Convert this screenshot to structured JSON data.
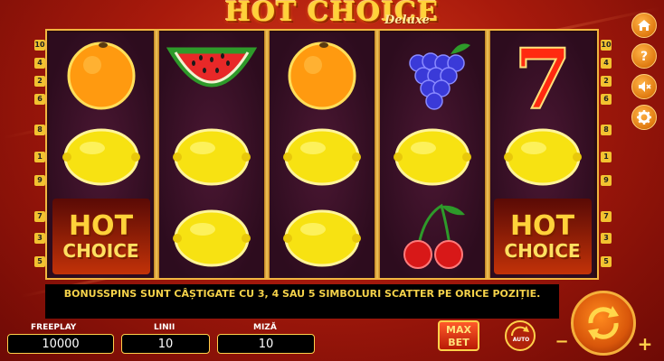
{
  "title": {
    "main": "HOT CHOICE",
    "sub": "Deluxe"
  },
  "reels": [
    [
      "orange",
      "lemon",
      "hot-choice"
    ],
    [
      "watermelon",
      "lemon",
      "lemon"
    ],
    [
      "orange",
      "lemon",
      "lemon"
    ],
    [
      "grapes",
      "lemon",
      "cherries"
    ],
    [
      "seven",
      "lemon",
      "hot-choice"
    ]
  ],
  "hot_choice_logo": {
    "line1": "HOT",
    "line2": "CHOICE"
  },
  "line_numbers_left": [
    "10",
    "4",
    "2",
    "6",
    "8",
    "1",
    "9",
    "7",
    "3",
    "5"
  ],
  "line_numbers_right": [
    "10",
    "4",
    "2",
    "6",
    "8",
    "1",
    "9",
    "7",
    "3",
    "5"
  ],
  "side_buttons": [
    "home-icon",
    "help-icon",
    "sound-off-icon",
    "settings-icon"
  ],
  "message": "BONUSSPINS SUNT CÂȘTIGATE CU 3, 4 SAU 5 SIMBOLURI SCATTER PE ORICE POZIȚIE.",
  "bottom": {
    "freeplay_label": "FREEPLAY",
    "freeplay_value": "10000",
    "lines_label": "LINII",
    "lines_value": "10",
    "bet_label": "MIZĂ",
    "bet_value": "10",
    "maxbet_line1": "MAX",
    "maxbet_line2": "BET",
    "auto_label": "AUTO",
    "minus": "−",
    "plus": "+"
  },
  "colors": {
    "accent_gold": "#f1b640",
    "background_red": "#b0220a",
    "reel_bg": "#2d0c1e"
  }
}
